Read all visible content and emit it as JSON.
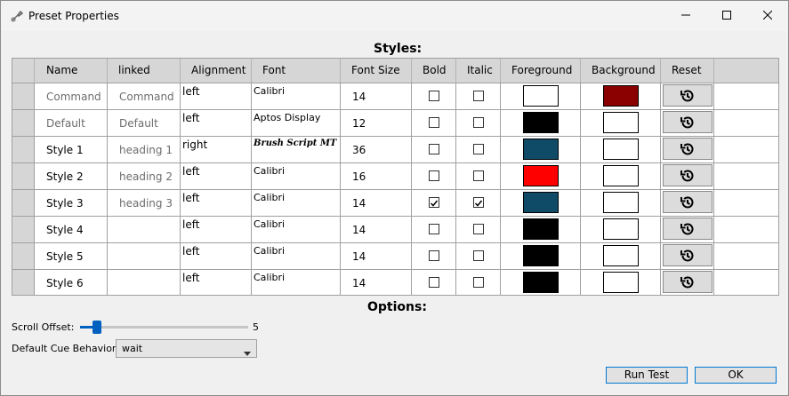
{
  "window": {
    "title": "Preset Properties"
  },
  "styles_heading": "Styles:",
  "options_heading": "Options:",
  "table": {
    "columns": [
      "Name",
      "linked",
      "Alignment",
      "Font",
      "Font Size",
      "Bold",
      "Italic",
      "Foreground",
      "Background",
      "Reset"
    ],
    "rows": [
      {
        "name": "Command",
        "linked": "Command",
        "alignment": "left",
        "font": "Calibri",
        "font_size": "14",
        "bold": false,
        "italic": false,
        "foreground": "#ffffff",
        "background": "#8b0000",
        "name_gray": true
      },
      {
        "name": "Default",
        "linked": "Default",
        "alignment": "left",
        "font": "Aptos Display",
        "font_size": "12",
        "bold": false,
        "italic": false,
        "foreground": "#000000",
        "background": "#ffffff",
        "name_gray": true
      },
      {
        "name": "Style 1",
        "linked": "heading 1",
        "alignment": "right",
        "font": "Brush Script MT",
        "font_size": "36",
        "bold": false,
        "italic": false,
        "foreground": "#0f4a66",
        "background": "#ffffff",
        "name_gray": false
      },
      {
        "name": "Style 2",
        "linked": "heading 2",
        "alignment": "left",
        "font": "Calibri",
        "font_size": "16",
        "bold": false,
        "italic": false,
        "foreground": "#ff0000",
        "background": "#ffffff",
        "name_gray": false
      },
      {
        "name": "Style 3",
        "linked": "heading 3",
        "alignment": "left",
        "font": "Calibri",
        "font_size": "14",
        "bold": true,
        "italic": true,
        "foreground": "#0f4a66",
        "background": "#ffffff",
        "name_gray": false
      },
      {
        "name": "Style 4",
        "linked": "",
        "alignment": "left",
        "font": "Calibri",
        "font_size": "14",
        "bold": false,
        "italic": false,
        "foreground": "#000000",
        "background": "#ffffff",
        "name_gray": false
      },
      {
        "name": "Style 5",
        "linked": "",
        "alignment": "left",
        "font": "Calibri",
        "font_size": "14",
        "bold": false,
        "italic": false,
        "foreground": "#000000",
        "background": "#ffffff",
        "name_gray": false
      },
      {
        "name": "Style 6",
        "linked": "",
        "alignment": "left",
        "font": "Calibri",
        "font_size": "14",
        "bold": false,
        "italic": false,
        "foreground": "#000000",
        "background": "#ffffff",
        "name_gray": false
      }
    ]
  },
  "options": {
    "scroll_offset_label": "Scroll Offset:",
    "scroll_offset_value": "5",
    "scroll_offset_fraction": 0.1,
    "cue_label": "Default Cue Behavior:",
    "cue_value": "wait"
  },
  "buttons": {
    "run_test": "Run Test",
    "ok": "OK"
  },
  "colors": {
    "accent": "#0060c0",
    "header_bg": "#d6d6d6"
  },
  "icons": {
    "app": "wrench-icon",
    "reset": "history-icon"
  }
}
